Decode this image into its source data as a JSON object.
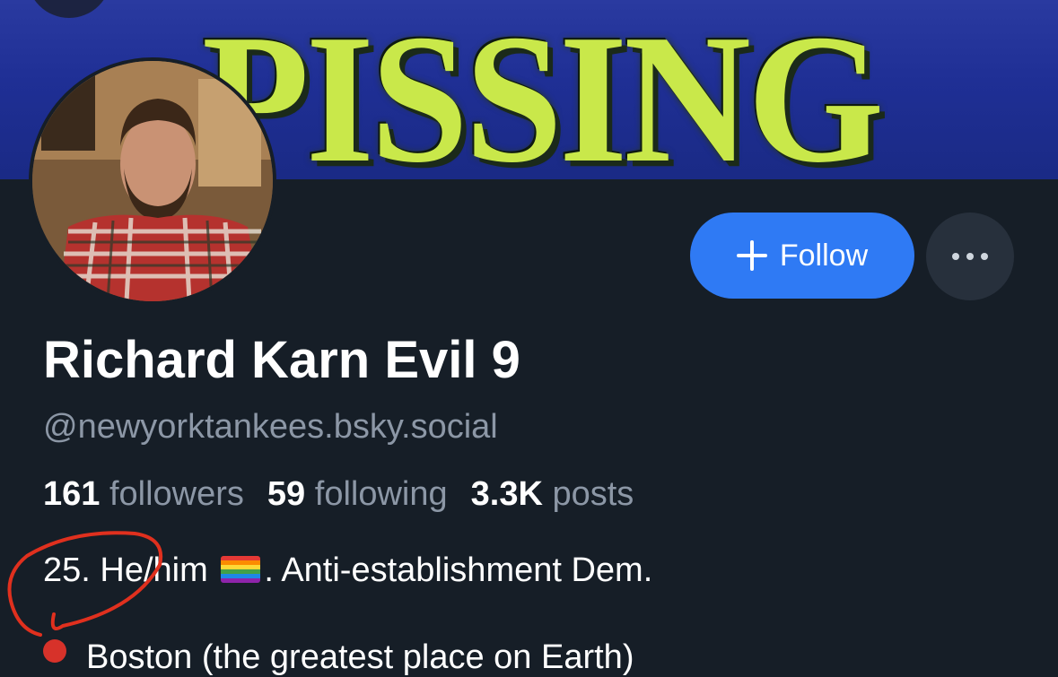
{
  "banner": {
    "text": "PISSING"
  },
  "profile": {
    "display_name": "Richard Karn Evil 9",
    "handle": "@newyorktankees.bsky.social"
  },
  "actions": {
    "follow_label": "Follow"
  },
  "stats": [
    {
      "count": "161",
      "label": "followers"
    },
    {
      "count": "59",
      "label": "following"
    },
    {
      "count": "3.3K",
      "label": "posts"
    }
  ],
  "bio": {
    "line1_pre": "25. He/him",
    "line1_post": ". Anti-establishment Dem.",
    "line2": "Boston (the greatest place on Earth)"
  },
  "icons": {
    "follow": "plus-icon",
    "more": "ellipsis-icon",
    "flag": "rainbow-flag-icon",
    "location": "pushpin-icon"
  },
  "colors": {
    "accent": "#2f7af4",
    "background": "#161e27",
    "annotation": "#e0301e"
  }
}
